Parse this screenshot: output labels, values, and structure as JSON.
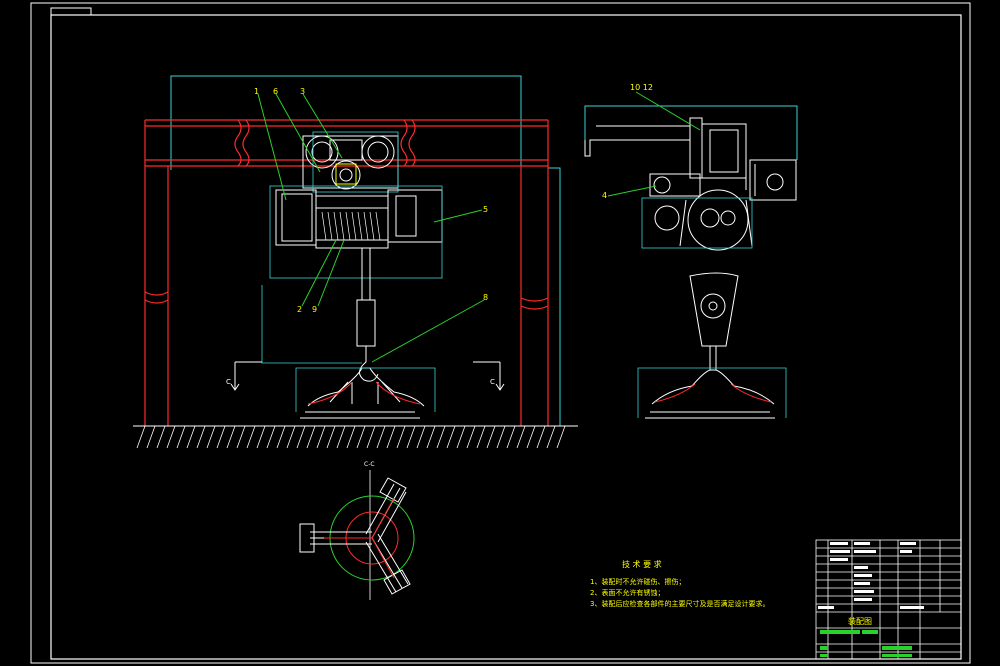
{
  "colors": {
    "background": "#000000",
    "frame": "#ffffff",
    "outline": "#ff2a2a",
    "leader": "#2bd12b",
    "annotation": "#ffff00",
    "dimension": "#38d4d8",
    "title_block_text": "#ffffff"
  },
  "callouts": {
    "c1": "1",
    "c6": "6",
    "c3": "3",
    "c5": "5",
    "c2": "2",
    "c9": "9",
    "c8": "8",
    "c1012": "10 12",
    "c4": "4"
  },
  "section_marks": {
    "left": "C",
    "right": "C",
    "bottom_view": "C-C"
  },
  "tech_requirements": {
    "title": "技 术 要 求",
    "items": [
      "1、装配时不允许碰伤、擦伤；",
      "2、表面不允许有锈蚀；",
      "3、装配后应检查各部件的主要尺寸及是否满足设计要求。"
    ]
  },
  "title_block": {
    "drawing_title": "装配图"
  }
}
